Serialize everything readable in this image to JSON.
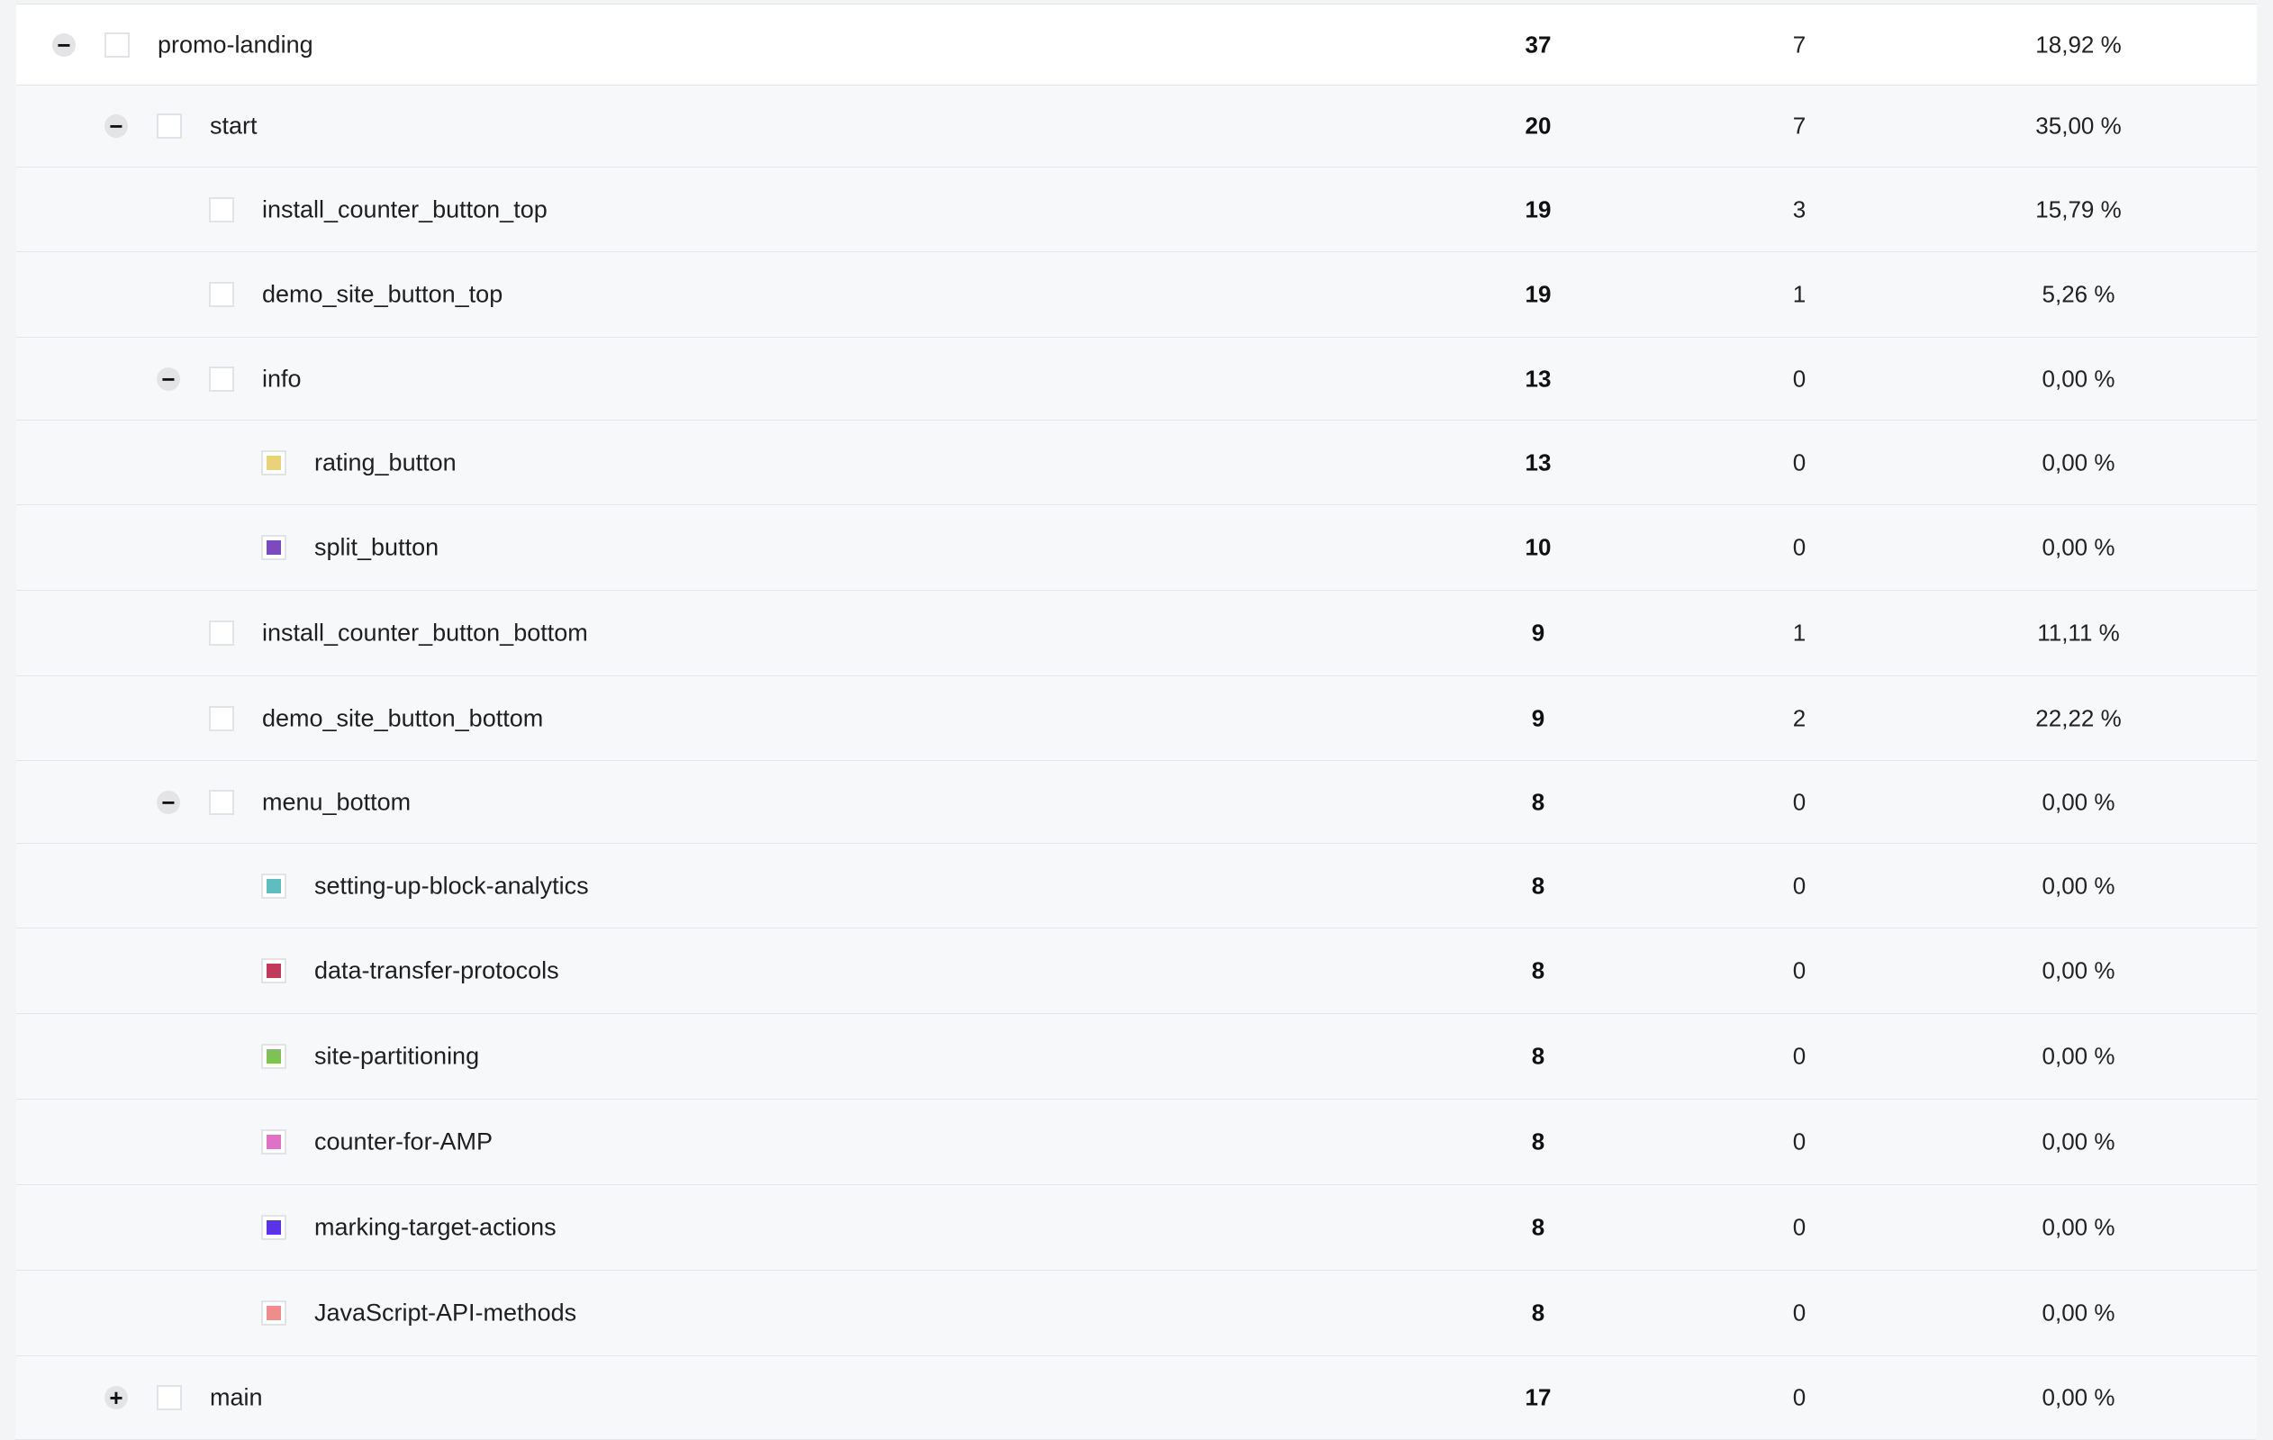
{
  "rows": [
    {
      "label": "promo-landing",
      "visits": "37",
      "conversions": "7",
      "rate": "18,92 %",
      "toggle": "−",
      "swatch": ""
    },
    {
      "label": "start",
      "visits": "20",
      "conversions": "7",
      "rate": "35,00 %",
      "toggle": "−",
      "swatch": ""
    },
    {
      "label": "install_counter_button_top",
      "visits": "19",
      "conversions": "3",
      "rate": "15,79 %",
      "toggle": "",
      "swatch": ""
    },
    {
      "label": "demo_site_button_top",
      "visits": "19",
      "conversions": "1",
      "rate": "5,26 %",
      "toggle": "",
      "swatch": ""
    },
    {
      "label": "info",
      "visits": "13",
      "conversions": "0",
      "rate": "0,00 %",
      "toggle": "−",
      "swatch": ""
    },
    {
      "label": "rating_button",
      "visits": "13",
      "conversions": "0",
      "rate": "0,00 %",
      "toggle": "",
      "swatch": "#e8d27a"
    },
    {
      "label": "split_button",
      "visits": "10",
      "conversions": "0",
      "rate": "0,00 %",
      "toggle": "",
      "swatch": "#7b4bbd"
    },
    {
      "label": "install_counter_button_bottom",
      "visits": "9",
      "conversions": "1",
      "rate": "11,11 %",
      "toggle": "",
      "swatch": ""
    },
    {
      "label": "demo_site_button_bottom",
      "visits": "9",
      "conversions": "2",
      "rate": "22,22 %",
      "toggle": "",
      "swatch": ""
    },
    {
      "label": "menu_bottom",
      "visits": "8",
      "conversions": "0",
      "rate": "0,00 %",
      "toggle": "−",
      "swatch": ""
    },
    {
      "label": "setting-up-block-analytics",
      "visits": "8",
      "conversions": "0",
      "rate": "0,00 %",
      "toggle": "",
      "swatch": "#5fbdbd"
    },
    {
      "label": "data-transfer-protocols",
      "visits": "8",
      "conversions": "0",
      "rate": "0,00 %",
      "toggle": "",
      "swatch": "#c23a5a"
    },
    {
      "label": "site-partitioning",
      "visits": "8",
      "conversions": "0",
      "rate": "0,00 %",
      "toggle": "",
      "swatch": "#7fc152"
    },
    {
      "label": "counter-for-AMP",
      "visits": "8",
      "conversions": "0",
      "rate": "0,00 %",
      "toggle": "",
      "swatch": "#dd72c6"
    },
    {
      "label": "marking-target-actions",
      "visits": "8",
      "conversions": "0",
      "rate": "0,00 %",
      "toggle": "",
      "swatch": "#5a32e8"
    },
    {
      "label": "JavaScript-API-methods",
      "visits": "8",
      "conversions": "0",
      "rate": "0,00 %",
      "toggle": "",
      "swatch": "#ee8e8c"
    },
    {
      "label": "main",
      "visits": "17",
      "conversions": "0",
      "rate": "0,00 %",
      "toggle": "+",
      "swatch": ""
    }
  ]
}
